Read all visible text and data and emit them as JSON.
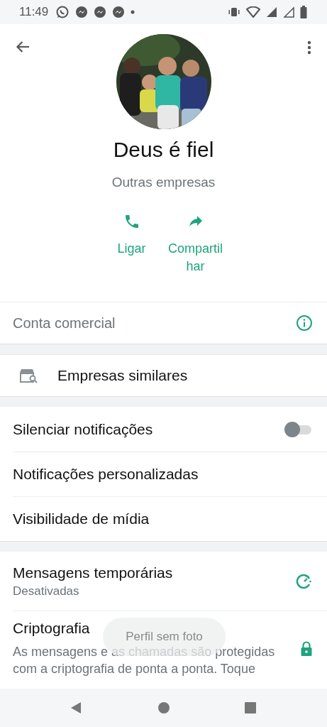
{
  "status_bar": {
    "time": "11:49"
  },
  "profile": {
    "name": "Deus é fiel",
    "category": "Outras empresas"
  },
  "actions": [
    {
      "kind": "call",
      "label": "Ligar"
    },
    {
      "kind": "share",
      "label": "Compartil\nhar"
    }
  ],
  "business_account": {
    "label": "Conta comercial"
  },
  "similar": {
    "label": "Empresas similares"
  },
  "settings": [
    {
      "kind": "toggle",
      "label": "Silenciar notificações",
      "on": false
    },
    {
      "kind": "plain",
      "label": "Notificações personalizadas"
    },
    {
      "kind": "plain",
      "label": "Visibilidade de mídia"
    }
  ],
  "disappearing": {
    "title": "Mensagens temporárias",
    "subtitle": "Desativadas"
  },
  "encryption": {
    "title": "Criptografia",
    "description": "As mensagens e as chamadas são protegidas com a criptografia de ponta a ponta. Toque"
  },
  "toast": "Perfil sem foto"
}
